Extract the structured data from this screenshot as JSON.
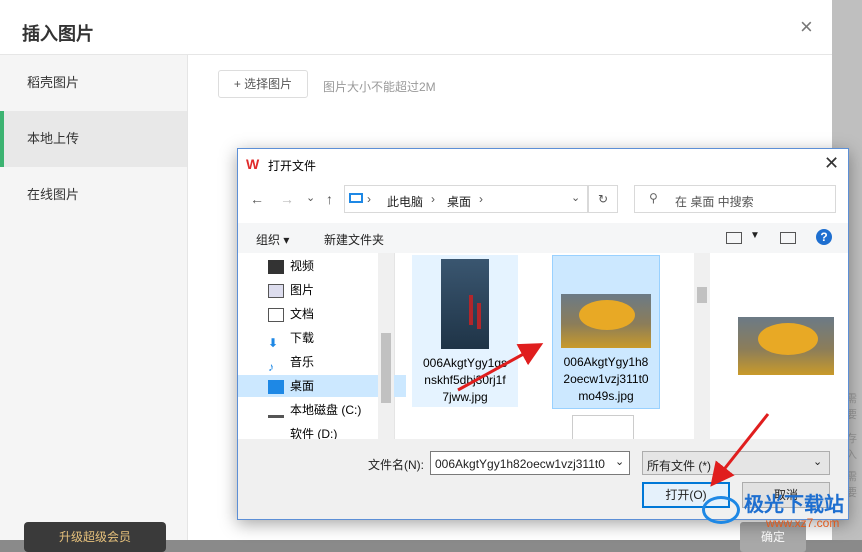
{
  "bg_dialog": {
    "title": "插入图片",
    "close": "×",
    "sidebar": [
      {
        "label": "稻壳图片"
      },
      {
        "label": "本地上传"
      },
      {
        "label": "在线图片"
      }
    ],
    "select_button": "+ 选择图片",
    "size_hint": "图片大小不能超过2M",
    "upgrade_button": "升级超级会员",
    "confirm_button": "确定",
    "side_notes": [
      "需要",
      "存入",
      "需要"
    ]
  },
  "file_dialog": {
    "title": "打开文件",
    "nav": {
      "back": "←",
      "forward": "→",
      "down": "⌄",
      "up": "↑"
    },
    "breadcrumb": [
      "此电脑",
      "桌面"
    ],
    "search_placeholder": "在 桌面 中搜索",
    "toolbar": {
      "organize": "组织 ▾",
      "new_folder": "新建文件夹"
    },
    "tree": [
      {
        "label": "视频",
        "icon": "video-icon"
      },
      {
        "label": "图片",
        "icon": "picture-icon"
      },
      {
        "label": "文档",
        "icon": "document-icon"
      },
      {
        "label": "下载",
        "icon": "download-icon"
      },
      {
        "label": "音乐",
        "icon": "music-icon"
      },
      {
        "label": "桌面",
        "icon": "desktop-icon"
      },
      {
        "label": "本地磁盘 (C:)",
        "icon": "drive-icon"
      },
      {
        "label": "软件 (D:)",
        "icon": "drive-icon"
      }
    ],
    "files": [
      {
        "name_lines": [
          "006AkgtYgy1gs",
          "nskhf5dbj30rj1f",
          "7jww.jpg"
        ]
      },
      {
        "name_lines": [
          "006AkgtYgy1h8",
          "2oecw1vzj311t0",
          "mo49s.jpg"
        ]
      }
    ],
    "filename_label": "文件名(N):",
    "filename_value": "006AkgtYgy1h82oecw1vzj311t0",
    "filetype_value": "所有文件 (*)",
    "open_button": "打开(O)",
    "cancel_button": "取消"
  },
  "watermark": {
    "text": "极光下载站",
    "url": "www.xz7.com"
  },
  "colors": {
    "accent_green": "#3cb371",
    "arrow_red": "#e01e1e",
    "selection_blue": "#cce8ff"
  }
}
